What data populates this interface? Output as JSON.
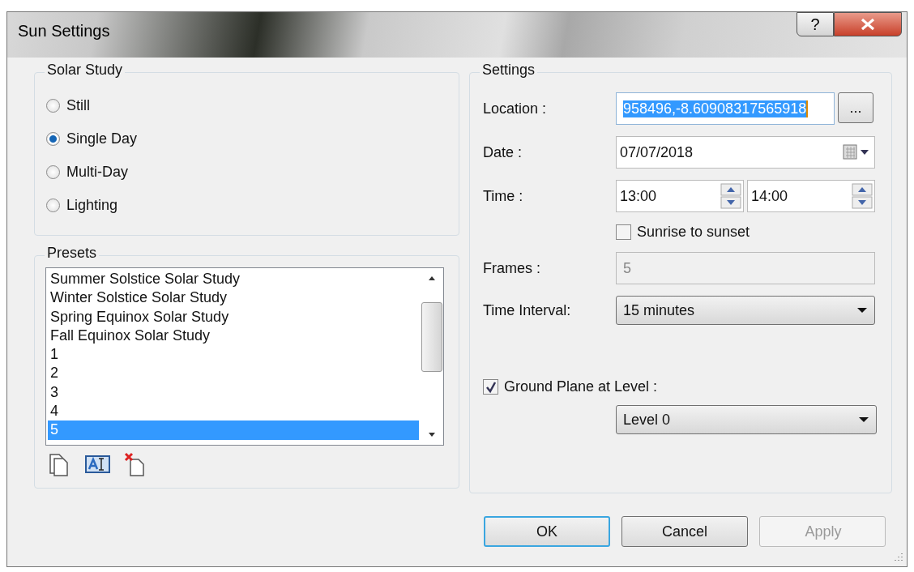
{
  "window": {
    "title": "Sun Settings",
    "help": "?"
  },
  "solar_study": {
    "title": "Solar Study",
    "options": [
      {
        "label": "Still",
        "selected": false
      },
      {
        "label": "Single Day",
        "selected": true
      },
      {
        "label": "Multi-Day",
        "selected": false
      },
      {
        "label": "Lighting",
        "selected": false
      }
    ]
  },
  "presets": {
    "title": "Presets",
    "items": [
      {
        "label": "Summer Solstice Solar Study",
        "selected": false
      },
      {
        "label": "Winter Solstice Solar Study",
        "selected": false
      },
      {
        "label": "Spring Equinox Solar Study",
        "selected": false
      },
      {
        "label": "Fall Equinox Solar Study",
        "selected": false
      },
      {
        "label": "1",
        "selected": false
      },
      {
        "label": "2",
        "selected": false
      },
      {
        "label": "3",
        "selected": false
      },
      {
        "label": "4",
        "selected": false
      },
      {
        "label": "5",
        "selected": true
      }
    ]
  },
  "settings": {
    "title": "Settings",
    "location": {
      "label": "Location :",
      "value": "958496,-8.60908317565918",
      "highlighted": true,
      "browse": "..."
    },
    "date": {
      "label": "Date :",
      "value": "07/07/2018"
    },
    "time": {
      "label": "Time :",
      "start": "13:00",
      "end": "14:00"
    },
    "sunrise": {
      "label": "Sunrise to sunset",
      "checked": false
    },
    "frames": {
      "label": "Frames :",
      "value": "5",
      "disabled": true
    },
    "interval": {
      "label": "Time Interval:",
      "value": "15 minutes"
    },
    "ground_plane": {
      "label": "Ground Plane at Level :",
      "checked": true,
      "value": "Level 0"
    }
  },
  "buttons": [
    {
      "label": "OK",
      "kind": "default",
      "disabled": false
    },
    {
      "label": "Cancel",
      "kind": "normal",
      "disabled": false
    },
    {
      "label": "Apply",
      "kind": "normal",
      "disabled": true
    }
  ]
}
